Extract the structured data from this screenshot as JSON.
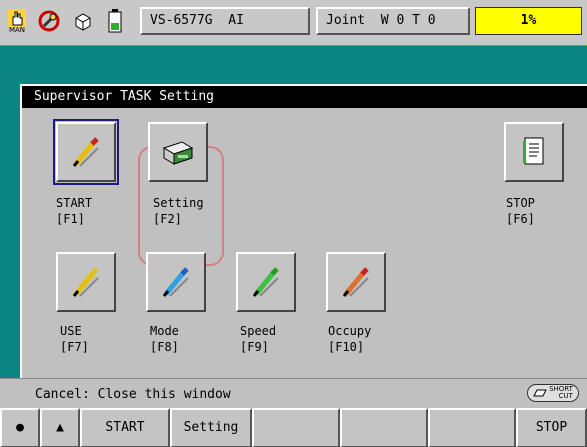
{
  "status_bar": {
    "mode_text": "MAN",
    "robot_model": "VS-6577G  AI",
    "coord_mode": "Joint  W 0 T 0",
    "speed_percent": "1%",
    "icons": [
      "hand-icon",
      "key-icon",
      "package-icon",
      "battery-icon"
    ]
  },
  "dialog": {
    "title": "Supervisor TASK Setting",
    "buttons": [
      {
        "name": "START",
        "key": "[F1]",
        "icon": "pencil-icon"
      },
      {
        "name": "Setting",
        "key": "[F2]",
        "icon": "device-icon"
      },
      {
        "name": "STOP",
        "key": "[F6]",
        "icon": "document-icon"
      },
      {
        "name": "USE",
        "key": "[F7]",
        "icon": "pencil-icon"
      },
      {
        "name": "Mode",
        "key": "[F8]",
        "icon": "pencil-icon"
      },
      {
        "name": "Speed",
        "key": "[F9]",
        "icon": "pencil-icon"
      },
      {
        "name": "Occupy",
        "key": "[F10]",
        "icon": "pencil-icon"
      }
    ]
  },
  "bottom": {
    "cancel_text": "Cancel: Close this window",
    "shortcut_top": "SHORT",
    "shortcut_bottom": "CUT"
  },
  "fkeys": [
    "●",
    "▲",
    "START",
    "Setting",
    "",
    "",
    "",
    "",
    "STOP"
  ],
  "colors": {
    "teal": "#0c8585",
    "speed_bg": "#ffff00",
    "highlight": "#d28080"
  }
}
